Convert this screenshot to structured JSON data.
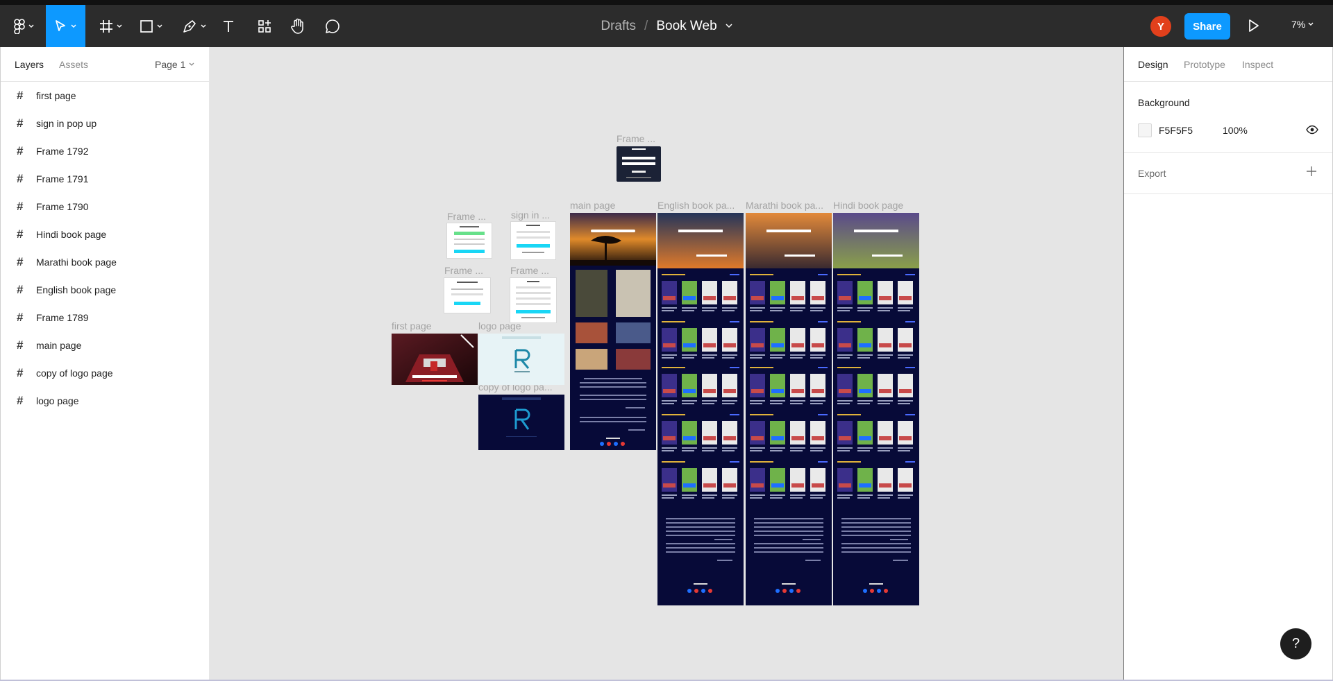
{
  "toolbar": {
    "breadcrumb_folder": "Drafts",
    "breadcrumb_separator": "/",
    "file_name": "Book Web",
    "avatar_initial": "Y",
    "share_label": "Share",
    "zoom_level": "7%"
  },
  "left_panel": {
    "tab_layers": "Layers",
    "tab_assets": "Assets",
    "page_selector": "Page 1",
    "layers": [
      {
        "name": "first page"
      },
      {
        "name": "sign in pop up"
      },
      {
        "name": "Frame 1792"
      },
      {
        "name": "Frame 1791"
      },
      {
        "name": "Frame 1790"
      },
      {
        "name": "Hindi book page"
      },
      {
        "name": "Marathi book page"
      },
      {
        "name": "English book page"
      },
      {
        "name": "Frame 1789"
      },
      {
        "name": "main page"
      },
      {
        "name": "copy of logo page"
      },
      {
        "name": "logo page"
      }
    ]
  },
  "canvas": {
    "labels": {
      "frame_top": "Frame ...",
      "frame_a": "Frame ...",
      "sign_in": "sign in ...",
      "frame_b": "Frame ...",
      "frame_c": "Frame ...",
      "main_page": "main page",
      "english": "English book pa...",
      "marathi": "Marathi book pa...",
      "hindi": "Hindi book page",
      "first_page": "first page",
      "logo_page": "logo page",
      "copy_logo": "copy of logo pa..."
    },
    "background_color": "#E5E5E5"
  },
  "right_panel": {
    "tab_design": "Design",
    "tab_prototype": "Prototype",
    "tab_inspect": "Inspect",
    "background_title": "Background",
    "background_hex": "F5F5F5",
    "background_opacity": "100%",
    "export_title": "Export"
  },
  "help_label": "?",
  "colors": {
    "toolbar": "#2C2C2C",
    "accent": "#0D99FF",
    "avatar": "#E2401C",
    "frame_navy": "#070A38"
  }
}
